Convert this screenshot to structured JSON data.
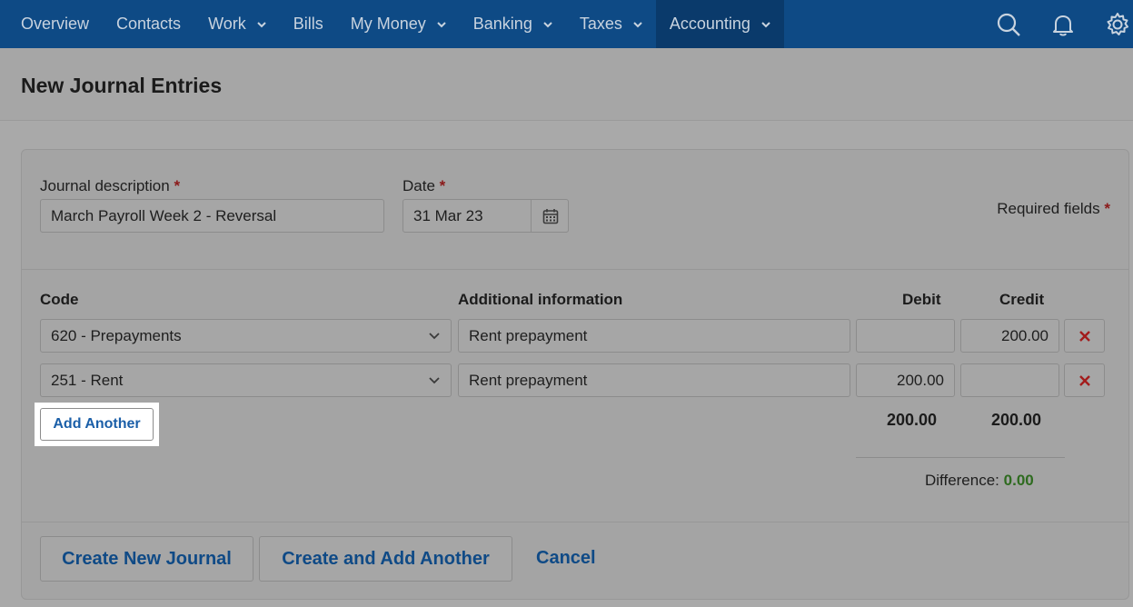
{
  "nav": {
    "items": [
      {
        "label": "Overview",
        "dropdown": false
      },
      {
        "label": "Contacts",
        "dropdown": false
      },
      {
        "label": "Work",
        "dropdown": true
      },
      {
        "label": "Bills",
        "dropdown": false
      },
      {
        "label": "My Money",
        "dropdown": true
      },
      {
        "label": "Banking",
        "dropdown": true
      },
      {
        "label": "Taxes",
        "dropdown": true
      },
      {
        "label": "Accounting",
        "dropdown": true,
        "active": true
      }
    ],
    "icons": [
      "search-icon",
      "bell-icon",
      "gear-icon"
    ],
    "bg_color": "#0e4a85"
  },
  "page": {
    "title": "New Journal Entries"
  },
  "form": {
    "description_label": "Journal description",
    "description_value": "March Payroll Week 2 - Reversal",
    "date_label": "Date",
    "date_value": "31 Mar 23",
    "required_note": "Required fields",
    "required_marker": "*"
  },
  "table": {
    "headers": {
      "code": "Code",
      "info": "Additional information",
      "debit": "Debit",
      "credit": "Credit"
    },
    "rows": [
      {
        "code": "620 - Prepayments",
        "info": "Rent prepayment",
        "debit": "",
        "credit": "200.00"
      },
      {
        "code": "251 - Rent",
        "info": "Rent prepayment",
        "debit": "200.00",
        "credit": ""
      }
    ],
    "add_another_label": "Add Another",
    "total_debit": "200.00",
    "total_credit": "200.00",
    "difference_label": "Difference:",
    "difference_value": "0.00"
  },
  "actions": {
    "create_new": "Create New Journal",
    "create_add_another": "Create and Add Another",
    "cancel": "Cancel"
  }
}
